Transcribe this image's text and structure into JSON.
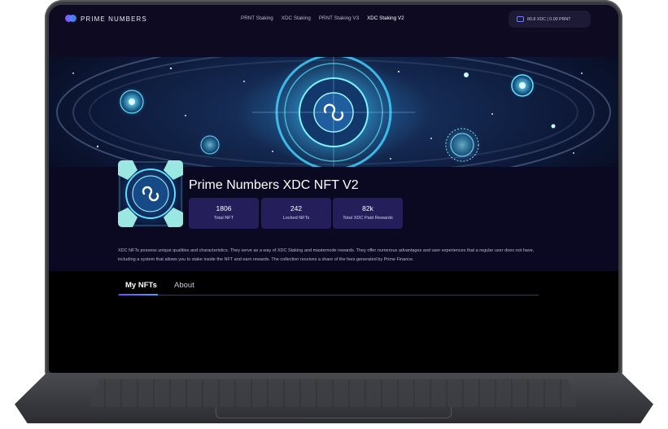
{
  "brand": {
    "name": "PRIME NUMBERS",
    "logo_icon": "prime-numbers-logo"
  },
  "nav": {
    "items": [
      {
        "label": "PRNT Staking",
        "active": false
      },
      {
        "label": "XDC Staking",
        "active": false
      },
      {
        "label": "PRNT Staking V3",
        "active": false
      },
      {
        "label": "XDC Staking V2",
        "active": true
      }
    ]
  },
  "wallet": {
    "icon": "wallet-icon",
    "balance": "80.8 XDC | 0.00 PRNT"
  },
  "collection": {
    "title": "Prime Numbers XDC NFT V2",
    "stats": [
      {
        "value": "1806",
        "label": "Total NFT"
      },
      {
        "value": "242",
        "label": "Locked NFTs"
      },
      {
        "value": "82k",
        "label": "Total XDC Paid Rewards"
      }
    ],
    "description": "XDC NFTs possess unique qualities and characteristics. They serve as a way of XDC Staking and masternode rewards. They offer numerous advantages and user experiences that a regular user does not have, including a system that allows you to stake inside the NFT and earn rewards. The collection receives a share of the fees generated by Prime Finance."
  },
  "tabs": [
    {
      "label": "My NFTs",
      "active": true
    },
    {
      "label": "About",
      "active": false
    }
  ],
  "colors": {
    "background": "#0b0821",
    "accent": "#241e5a",
    "tab_gradient_start": "#6e4bff",
    "tab_gradient_end": "#3aa7ff"
  }
}
